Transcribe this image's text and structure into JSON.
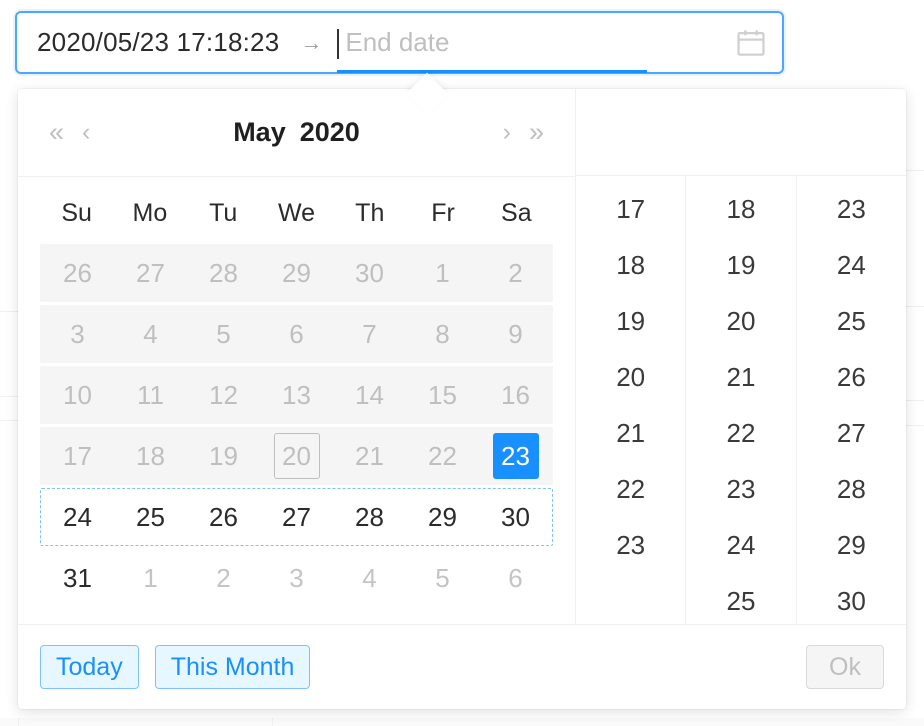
{
  "input": {
    "start_value": "2020/05/23 17:18:23",
    "separator": "→",
    "end_placeholder": "End date",
    "icon": "calendar-icon",
    "focused": true,
    "accent_color": "#1890ff"
  },
  "popup": {
    "header": {
      "super_prev": "«",
      "prev": "‹",
      "month": "May",
      "year": "2020",
      "next": "›",
      "super_next": "»"
    },
    "weekdays": [
      "Su",
      "Mo",
      "Tu",
      "We",
      "Th",
      "Fr",
      "Sa"
    ],
    "weeks": [
      {
        "state": "disabled",
        "days": [
          {
            "label": "26",
            "state": "dim"
          },
          {
            "label": "27",
            "state": "dim"
          },
          {
            "label": "28",
            "state": "dim"
          },
          {
            "label": "29",
            "state": "dim"
          },
          {
            "label": "30",
            "state": "dim"
          },
          {
            "label": "1",
            "state": "dim"
          },
          {
            "label": "2",
            "state": "dim"
          }
        ]
      },
      {
        "state": "disabled",
        "days": [
          {
            "label": "3",
            "state": "dim"
          },
          {
            "label": "4",
            "state": "dim"
          },
          {
            "label": "5",
            "state": "dim"
          },
          {
            "label": "6",
            "state": "dim"
          },
          {
            "label": "7",
            "state": "dim"
          },
          {
            "label": "8",
            "state": "dim"
          },
          {
            "label": "9",
            "state": "dim"
          }
        ]
      },
      {
        "state": "disabled",
        "days": [
          {
            "label": "10",
            "state": "dim"
          },
          {
            "label": "11",
            "state": "dim"
          },
          {
            "label": "12",
            "state": "dim"
          },
          {
            "label": "13",
            "state": "dim"
          },
          {
            "label": "14",
            "state": "dim"
          },
          {
            "label": "15",
            "state": "dim"
          },
          {
            "label": "16",
            "state": "dim"
          }
        ]
      },
      {
        "state": "disabled",
        "days": [
          {
            "label": "17",
            "state": "dim"
          },
          {
            "label": "18",
            "state": "dim"
          },
          {
            "label": "19",
            "state": "dim"
          },
          {
            "label": "20",
            "state": "today"
          },
          {
            "label": "21",
            "state": "dim"
          },
          {
            "label": "22",
            "state": "dim"
          },
          {
            "label": "23",
            "state": "selected"
          }
        ]
      },
      {
        "state": "range",
        "days": [
          {
            "label": "24",
            "state": "normal"
          },
          {
            "label": "25",
            "state": "normal"
          },
          {
            "label": "26",
            "state": "normal"
          },
          {
            "label": "27",
            "state": "normal"
          },
          {
            "label": "28",
            "state": "normal"
          },
          {
            "label": "29",
            "state": "normal"
          },
          {
            "label": "30",
            "state": "normal"
          }
        ]
      },
      {
        "state": "normal",
        "days": [
          {
            "label": "31",
            "state": "normal"
          },
          {
            "label": "1",
            "state": "muted"
          },
          {
            "label": "2",
            "state": "muted"
          },
          {
            "label": "3",
            "state": "muted"
          },
          {
            "label": "4",
            "state": "muted"
          },
          {
            "label": "5",
            "state": "muted"
          },
          {
            "label": "6",
            "state": "muted"
          }
        ]
      }
    ],
    "time_columns": [
      {
        "name": "hour-column",
        "values": [
          "17",
          "18",
          "19",
          "20",
          "21",
          "22",
          "23"
        ]
      },
      {
        "name": "minute-column",
        "values": [
          "18",
          "19",
          "20",
          "21",
          "22",
          "23",
          "24",
          "25"
        ]
      },
      {
        "name": "second-column",
        "values": [
          "23",
          "24",
          "25",
          "26",
          "27",
          "28",
          "29",
          "30"
        ]
      }
    ],
    "footer": {
      "today_label": "Today",
      "this_month_label": "This Month",
      "ok_label": "Ok",
      "ok_disabled": true
    }
  }
}
